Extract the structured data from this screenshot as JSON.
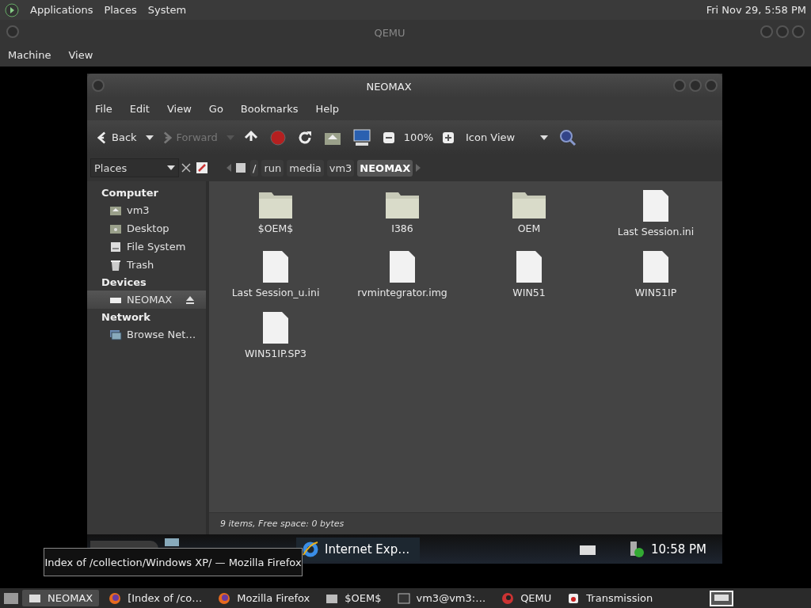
{
  "top_panel": {
    "menus": [
      "Applications",
      "Places",
      "System"
    ],
    "clock": "Fri Nov 29,  5:58 PM"
  },
  "qemu": {
    "title": "QEMU",
    "menus": [
      "Machine",
      "View"
    ]
  },
  "file_manager": {
    "title": "NEOMAX",
    "menus": [
      "File",
      "Edit",
      "View",
      "Go",
      "Bookmarks",
      "Help"
    ],
    "toolbar": {
      "back": {
        "label": "Back",
        "disabled": false
      },
      "forward": {
        "label": "Forward",
        "disabled": true
      },
      "zoom": "100%",
      "view": "Icon View"
    },
    "sidebar": {
      "selector": "Places",
      "sections": [
        {
          "heading": "Computer",
          "items": [
            {
              "label": "vm3",
              "kind": "home",
              "selected": false
            },
            {
              "label": "Desktop",
              "kind": "desktop",
              "selected": false
            },
            {
              "label": "File System",
              "kind": "drive",
              "selected": false
            },
            {
              "label": "Trash",
              "kind": "trash",
              "selected": false
            }
          ]
        },
        {
          "heading": "Devices",
          "items": [
            {
              "label": "NEOMAX",
              "kind": "device",
              "selected": true
            }
          ]
        },
        {
          "heading": "Network",
          "items": [
            {
              "label": "Browse Net…",
              "kind": "network",
              "selected": false
            }
          ]
        }
      ]
    },
    "breadcrumbs": [
      {
        "label": "/",
        "selected": false
      },
      {
        "label": "run",
        "selected": false
      },
      {
        "label": "media",
        "selected": false
      },
      {
        "label": "vm3",
        "selected": false
      },
      {
        "label": "NEOMAX",
        "selected": true
      }
    ],
    "files": [
      {
        "name": "$OEM$",
        "kind": "folder"
      },
      {
        "name": "I386",
        "kind": "folder"
      },
      {
        "name": "OEM",
        "kind": "folder"
      },
      {
        "name": "Last Session.ini",
        "kind": "file"
      },
      {
        "name": "Last Session_u.ini",
        "kind": "file"
      },
      {
        "name": "rvmintegrator.img",
        "kind": "file"
      },
      {
        "name": "WIN51",
        "kind": "file"
      },
      {
        "name": "WIN51IP",
        "kind": "file"
      },
      {
        "name": "WIN51IP.SP3",
        "kind": "file"
      }
    ],
    "status": "9 items, Free space: 0 bytes"
  },
  "guest_taskbar": {
    "items": [
      "Internet Exp…"
    ],
    "clock": "10:58 PM"
  },
  "tooltip": "Index of /collection/Windows XP/ — Mozilla Firefox",
  "host_taskbar": {
    "items": [
      {
        "label": "NEOMAX",
        "kind": "window",
        "selected": true
      },
      {
        "label": "[Index of /co…",
        "kind": "firefox",
        "selected": false
      },
      {
        "label": "Mozilla Firefox",
        "kind": "firefox",
        "selected": false
      },
      {
        "label": "$OEM$",
        "kind": "folder",
        "selected": false
      },
      {
        "label": "vm3@vm3:…",
        "kind": "terminal",
        "selected": false
      },
      {
        "label": "QEMU",
        "kind": "qemu",
        "selected": false
      },
      {
        "label": "Transmission",
        "kind": "transmission",
        "selected": false
      }
    ]
  }
}
